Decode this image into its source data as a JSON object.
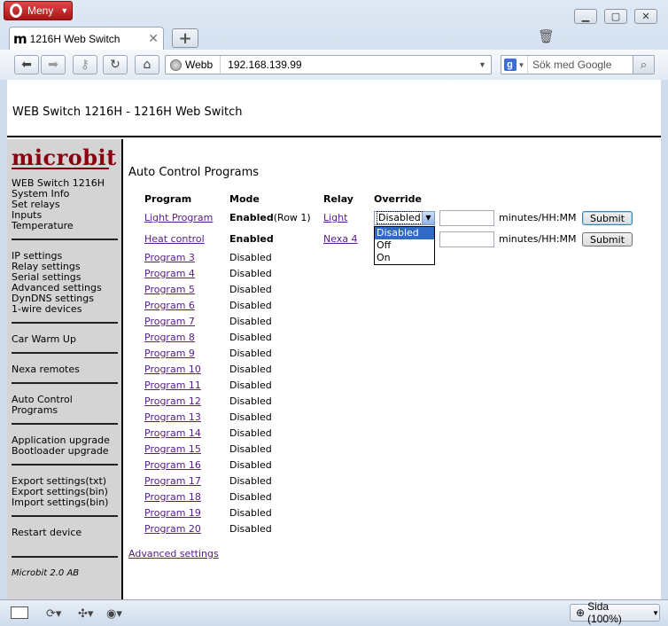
{
  "browser": {
    "menu_label": "Meny",
    "tab_title": "1216H Web Switch",
    "favicon_letter": "m",
    "site_label": "Webb",
    "url": "192.168.139.99",
    "search_placeholder": "Sök med Google",
    "zoom_label": "Sida (100%)"
  },
  "page": {
    "header_title": "WEB Switch 1216H - 1216H Web Switch",
    "logo": "microbit",
    "sidebar_groups": [
      [
        "WEB Switch 1216H",
        "System Info",
        "Set relays",
        "Inputs",
        "Temperature"
      ],
      [
        "IP settings",
        "Relay settings",
        "Serial settings",
        "Advanced settings",
        "DynDNS settings",
        "1-wire devices"
      ],
      [
        "Car Warm Up"
      ],
      [
        "Nexa remotes"
      ],
      [
        "Auto Control",
        "Programs"
      ],
      [
        "Application upgrade",
        "Bootloader upgrade"
      ],
      [
        "Export settings(txt)",
        "Export settings(bin)",
        "Import settings(bin)"
      ],
      [
        "Restart device"
      ]
    ],
    "sidebar_footer": "Microbit 2.0 AB",
    "main_title": "Auto Control Programs",
    "columns": {
      "program": "Program",
      "mode": "Mode",
      "relay": "Relay",
      "override": "Override"
    },
    "rows": [
      {
        "program": "Light Program",
        "mode": "Enabled",
        "mode_suffix": "(Row 1)",
        "relay": "Light"
      },
      {
        "program": "Heat control",
        "mode": "Enabled",
        "mode_suffix": "",
        "relay": "Nexa 4"
      },
      {
        "program": "Program 3",
        "mode": "Disabled"
      },
      {
        "program": "Program 4",
        "mode": "Disabled"
      },
      {
        "program": "Program 5",
        "mode": "Disabled"
      },
      {
        "program": "Program 6",
        "mode": "Disabled"
      },
      {
        "program": "Program 7",
        "mode": "Disabled"
      },
      {
        "program": "Program 8",
        "mode": "Disabled"
      },
      {
        "program": "Program 9",
        "mode": "Disabled"
      },
      {
        "program": "Program 10",
        "mode": "Disabled"
      },
      {
        "program": "Program 11",
        "mode": "Disabled"
      },
      {
        "program": "Program 12",
        "mode": "Disabled"
      },
      {
        "program": "Program 13",
        "mode": "Disabled"
      },
      {
        "program": "Program 14",
        "mode": "Disabled"
      },
      {
        "program": "Program 15",
        "mode": "Disabled"
      },
      {
        "program": "Program 16",
        "mode": "Disabled"
      },
      {
        "program": "Program 17",
        "mode": "Disabled"
      },
      {
        "program": "Program 18",
        "mode": "Disabled"
      },
      {
        "program": "Program 19",
        "mode": "Disabled"
      },
      {
        "program": "Program 20",
        "mode": "Disabled"
      }
    ],
    "override_selected": "Disabled",
    "override_options": [
      "Disabled",
      "Off",
      "On"
    ],
    "minutes_label": "minutes/HH:MM",
    "submit_label": "Submit",
    "advanced_link": "Advanced settings"
  }
}
